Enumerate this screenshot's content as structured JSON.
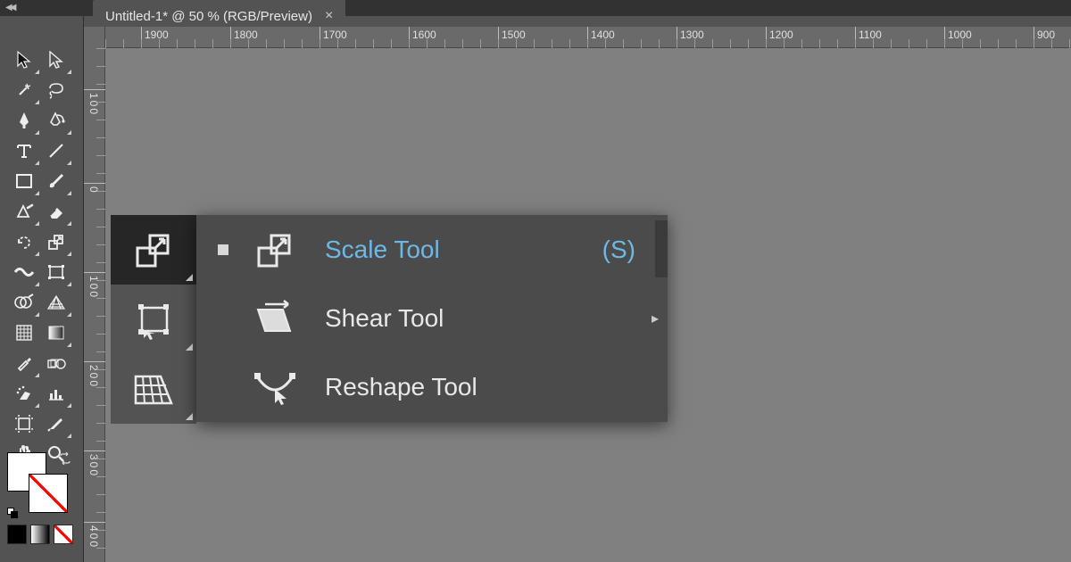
{
  "tab": {
    "title": "Untitled-1* @ 50 % (RGB/Preview)"
  },
  "ruler": {
    "h_ticks": [
      "1900",
      "1800",
      "1700",
      "1600",
      "1500",
      "1400",
      "1300",
      "1200",
      "1100",
      "1000",
      "900"
    ],
    "v_ticks": [
      "100",
      "0",
      "100",
      "200",
      "300",
      "400"
    ]
  },
  "tools": {
    "left_column": [
      [
        "selection",
        "direct-selection"
      ],
      [
        "magic-wand",
        "lasso"
      ],
      [
        "pen",
        "curvature-pen"
      ],
      [
        "type",
        "line-segment"
      ],
      [
        "rectangle",
        "paintbrush"
      ],
      [
        "shaper",
        "eraser"
      ],
      [
        "rotate",
        "scale"
      ],
      [
        "width",
        "warp"
      ],
      [
        "free-transform",
        "shape-builder"
      ],
      [
        "mesh",
        "gradient"
      ],
      [
        "eyedropper",
        "blend"
      ],
      [
        "symbol-sprayer",
        "column-graph"
      ],
      [
        "artboard",
        "slice"
      ],
      [
        "hand",
        "zoom"
      ]
    ]
  },
  "flyout_column": [
    "scale",
    "free-transform",
    "perspective-distort"
  ],
  "flyout_menu": {
    "items": [
      {
        "label": "Scale Tool",
        "shortcut": "(S)",
        "selected": true,
        "has_sub": false,
        "icon": "scale"
      },
      {
        "label": "Shear Tool",
        "shortcut": "",
        "selected": false,
        "has_sub": true,
        "icon": "shear"
      },
      {
        "label": "Reshape Tool",
        "shortcut": "",
        "selected": false,
        "has_sub": false,
        "icon": "reshape"
      }
    ]
  }
}
